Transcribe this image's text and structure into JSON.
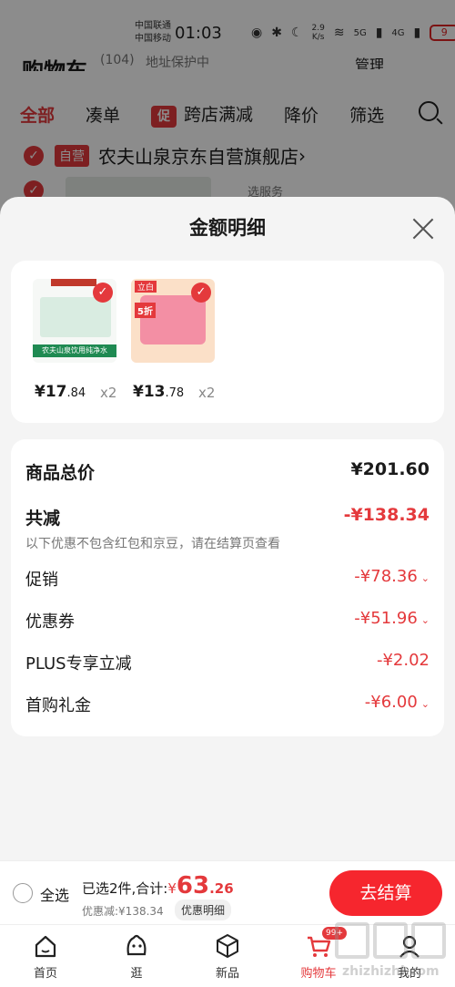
{
  "status_bar": {
    "carrier1": "中国联通",
    "carrier2": "中国移动",
    "time": "01:03",
    "speed_value": "2.9",
    "speed_unit": "K/s",
    "net1": "5G",
    "net2": "4G",
    "battery": "9"
  },
  "background": {
    "title": "购物车",
    "count": "(104)",
    "address": "地址保护中",
    "manage": "管理",
    "tabs": [
      "全部",
      "凑单",
      "跨店满减",
      "降价",
      "筛选"
    ],
    "promo_badge": "促",
    "store_tag": "自营",
    "store_name": "农夫山泉京东自营旗舰店",
    "store_arrow": "›",
    "service": "选服务"
  },
  "sheet": {
    "title": "金额明细",
    "products": [
      {
        "banner": "农夫山泉饮用纯净水",
        "price_symbol": "¥",
        "price_int": "17",
        "price_dec": ".84",
        "qty": "x2"
      },
      {
        "brand": "立白",
        "deal": "5折",
        "price_symbol": "¥",
        "price_int": "13",
        "price_dec": ".78",
        "qty": "x2"
      }
    ],
    "total_label": "商品总价",
    "total_value": "¥201.60",
    "reduce_label": "共减",
    "reduce_value": "-¥138.34",
    "note": "以下优惠不包含红包和京豆，请在结算页查看",
    "items": [
      {
        "label": "促销",
        "value": "-¥78.36",
        "expandable": true
      },
      {
        "label": "优惠券",
        "value": "-¥51.96",
        "expandable": true
      },
      {
        "label": "PLUS专享立减",
        "value": "-¥2.02",
        "expandable": false
      },
      {
        "label": "首购礼金",
        "value": "-¥6.00",
        "expandable": true
      }
    ],
    "chevron": "⌄"
  },
  "checkout": {
    "select_all": "全选",
    "selected_prefix": "已选2件,合计:",
    "currency": "¥",
    "total_int": "63",
    "total_dec": ".26",
    "saved": "优惠减:¥138.34",
    "detail_button": "优惠明细",
    "pay_button": "去结算"
  },
  "tabbar": {
    "items": [
      "首页",
      "逛",
      "新品",
      "购物车",
      "我的"
    ],
    "cart_badge": "99+",
    "active": "购物车"
  },
  "watermark": "zhizhizhi.com",
  "colors": {
    "accent": "#e4393c",
    "pay_button": "#f6262e"
  }
}
